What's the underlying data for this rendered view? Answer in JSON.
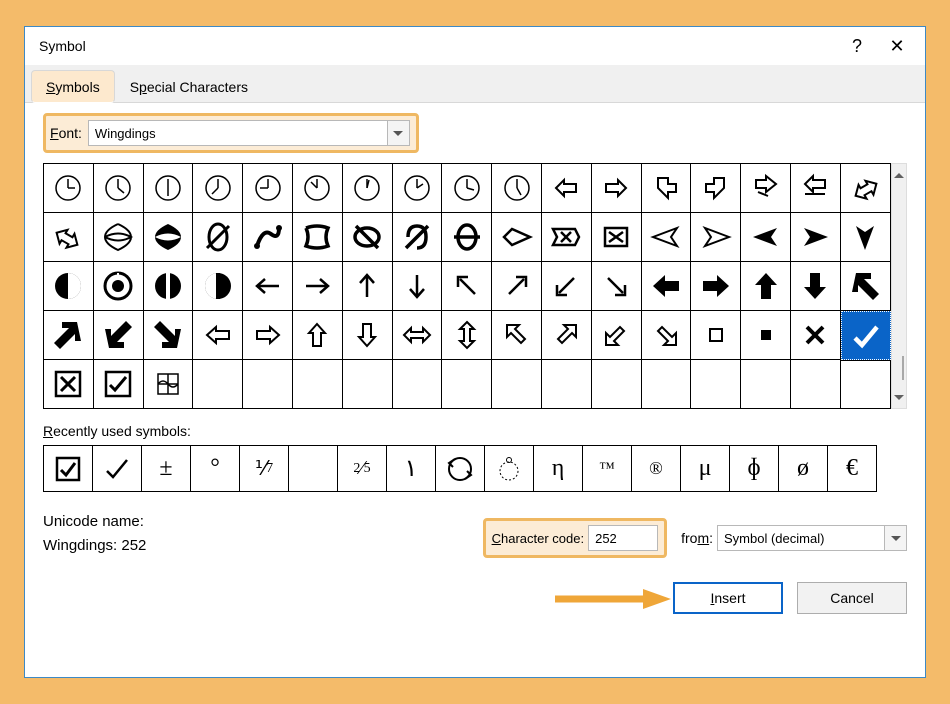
{
  "dialog": {
    "title": "Symbol",
    "help_icon": "?",
    "close_icon": "✕"
  },
  "tabs": {
    "symbols": "Symbols",
    "special": "Special Characters"
  },
  "font": {
    "label": "Font:",
    "value": "Wingdings"
  },
  "recent": {
    "label": "Recently used symbols:",
    "items": [
      "☑",
      "✓",
      "±",
      "°",
      "⅟₇",
      "",
      "⅖",
      "١",
      "↻",
      "◌̊",
      "η",
      "™",
      "®",
      "μ",
      "ɸ",
      "ø",
      "€"
    ]
  },
  "unicode": {
    "name_label": "Unicode name:",
    "name_value": "Wingdings: 252",
    "code_label": "Character code:",
    "code_value": "252",
    "from_label": "from:",
    "from_value": "Symbol (decimal)"
  },
  "buttons": {
    "insert": "Insert",
    "cancel": "Cancel"
  },
  "grid": {
    "selected_cell": "checkmark"
  }
}
